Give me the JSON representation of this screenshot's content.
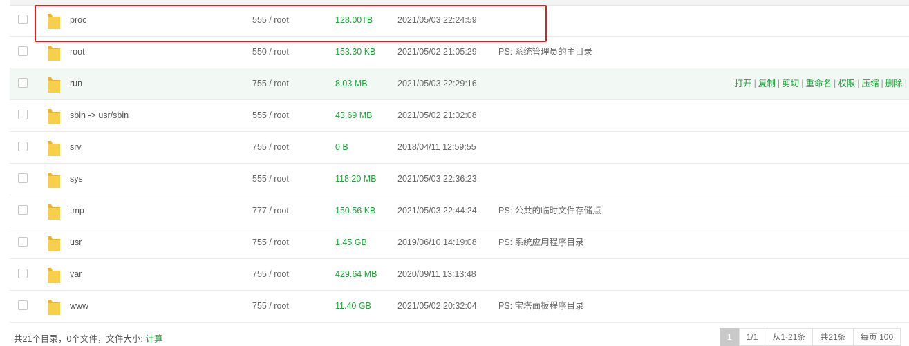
{
  "files": [
    {
      "name": "proc",
      "perm": "555 / root",
      "size": "128.00TB",
      "time": "2021/05/03 22:24:59",
      "ps": ""
    },
    {
      "name": "root",
      "perm": "550 / root",
      "size": "153.30 KB",
      "time": "2021/05/02 21:05:29",
      "ps": "PS: 系统管理员的主目录"
    },
    {
      "name": "run",
      "perm": "755 / root",
      "size": "8.03 MB",
      "time": "2021/05/03 22:29:16",
      "ps": ""
    },
    {
      "name": "sbin -> usr/sbin",
      "perm": "555 / root",
      "size": "43.69 MB",
      "time": "2021/05/02 21:02:08",
      "ps": ""
    },
    {
      "name": "srv",
      "perm": "755 / root",
      "size": "0 B",
      "time": "2018/04/11 12:59:55",
      "ps": ""
    },
    {
      "name": "sys",
      "perm": "555 / root",
      "size": "118.20 MB",
      "time": "2021/05/03 22:36:23",
      "ps": ""
    },
    {
      "name": "tmp",
      "perm": "777 / root",
      "size": "150.56 KB",
      "time": "2021/05/03 22:44:24",
      "ps": "PS: 公共的临时文件存储点"
    },
    {
      "name": "usr",
      "perm": "755 / root",
      "size": "1.45 GB",
      "time": "2019/06/10 14:19:08",
      "ps": "PS: 系统应用程序目录"
    },
    {
      "name": "var",
      "perm": "755 / root",
      "size": "429.64 MB",
      "time": "2020/09/11 13:13:48",
      "ps": ""
    },
    {
      "name": "www",
      "perm": "755 / root",
      "size": "11.40 GB",
      "time": "2021/05/02 20:32:04",
      "ps": "PS: 宝塔面板程序目录"
    }
  ],
  "row_actions": [
    "打开",
    "复制",
    "剪切",
    "重命名",
    "权限",
    "压缩",
    "删除"
  ],
  "footer": {
    "summary": "共21个目录，0个文件，文件大小:",
    "calc_link": "计算"
  },
  "pagination": {
    "current": "1",
    "pages": "1/1",
    "range": "从1-21条",
    "total": "共21条",
    "per_page": "每页 100"
  },
  "colors": {
    "accent": "#20a53a",
    "highlight_border": "#e51c1c",
    "folder": "#f5c844",
    "row_hover": "#f2f8f4"
  },
  "icons": {
    "folder": "folder-icon"
  }
}
